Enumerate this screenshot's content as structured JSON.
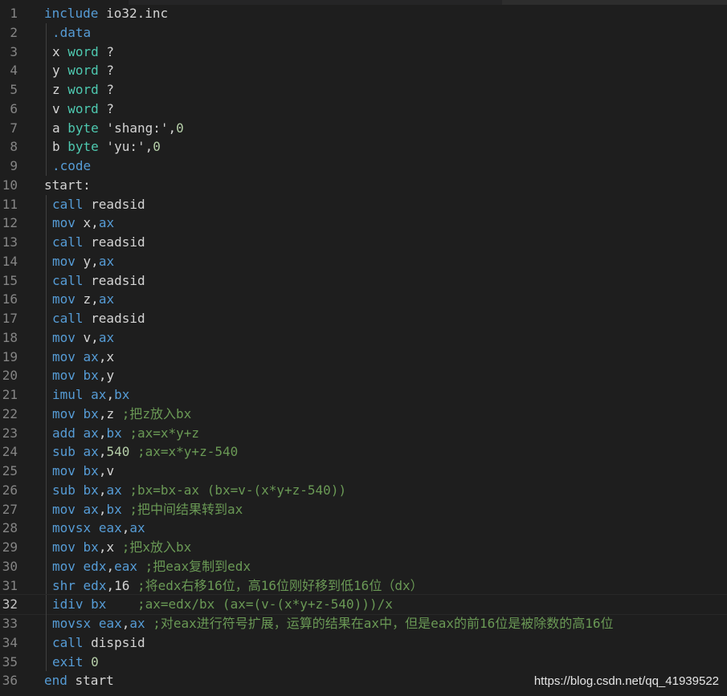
{
  "colors": {
    "background": "#1e1e1e",
    "line_number": "#858585",
    "keyword": "#569cd6",
    "type": "#4ec9b0",
    "number": "#b5cea8",
    "string": "#ce9178",
    "comment": "#6a9955",
    "text": "#d4d4d4"
  },
  "editor": {
    "current_line": 32,
    "lines": [
      {
        "n": "1",
        "indent": false,
        "tokens": [
          {
            "t": "kw",
            "v": "include"
          },
          {
            "t": "id",
            "v": " io32.inc"
          }
        ]
      },
      {
        "n": "2",
        "indent": true,
        "tokens": [
          {
            "t": "kw",
            "v": ".data"
          }
        ]
      },
      {
        "n": "3",
        "indent": true,
        "tokens": [
          {
            "t": "id",
            "v": "x "
          },
          {
            "t": "ty",
            "v": "word"
          },
          {
            "t": "id",
            "v": " ?"
          }
        ]
      },
      {
        "n": "4",
        "indent": true,
        "tokens": [
          {
            "t": "id",
            "v": "y "
          },
          {
            "t": "ty",
            "v": "word"
          },
          {
            "t": "id",
            "v": " ?"
          }
        ]
      },
      {
        "n": "5",
        "indent": true,
        "tokens": [
          {
            "t": "id",
            "v": "z "
          },
          {
            "t": "ty",
            "v": "word"
          },
          {
            "t": "id",
            "v": " ?"
          }
        ]
      },
      {
        "n": "6",
        "indent": true,
        "tokens": [
          {
            "t": "id",
            "v": "v "
          },
          {
            "t": "ty",
            "v": "word"
          },
          {
            "t": "id",
            "v": " ?"
          }
        ]
      },
      {
        "n": "7",
        "indent": true,
        "tokens": [
          {
            "t": "id",
            "v": "a "
          },
          {
            "t": "ty",
            "v": "byte"
          },
          {
            "t": "id",
            "v": " 'shang:',"
          },
          {
            "t": "num",
            "v": "0"
          }
        ]
      },
      {
        "n": "8",
        "indent": true,
        "tokens": [
          {
            "t": "id",
            "v": "b "
          },
          {
            "t": "ty",
            "v": "byte"
          },
          {
            "t": "id",
            "v": " 'yu:',"
          },
          {
            "t": "num",
            "v": "0"
          }
        ]
      },
      {
        "n": "9",
        "indent": true,
        "tokens": [
          {
            "t": "kw",
            "v": ".code"
          }
        ]
      },
      {
        "n": "10",
        "indent": false,
        "tokens": [
          {
            "t": "id",
            "v": "start:"
          }
        ]
      },
      {
        "n": "11",
        "indent": true,
        "tokens": [
          {
            "t": "kw",
            "v": "call"
          },
          {
            "t": "id",
            "v": " readsid"
          }
        ]
      },
      {
        "n": "12",
        "indent": true,
        "tokens": [
          {
            "t": "kw",
            "v": "mov"
          },
          {
            "t": "id",
            "v": " x,"
          },
          {
            "t": "reg",
            "v": "ax"
          }
        ]
      },
      {
        "n": "13",
        "indent": true,
        "tokens": [
          {
            "t": "kw",
            "v": "call"
          },
          {
            "t": "id",
            "v": " readsid"
          }
        ]
      },
      {
        "n": "14",
        "indent": true,
        "tokens": [
          {
            "t": "kw",
            "v": "mov"
          },
          {
            "t": "id",
            "v": " y,"
          },
          {
            "t": "reg",
            "v": "ax"
          }
        ]
      },
      {
        "n": "15",
        "indent": true,
        "tokens": [
          {
            "t": "kw",
            "v": "call"
          },
          {
            "t": "id",
            "v": " readsid"
          }
        ]
      },
      {
        "n": "16",
        "indent": true,
        "tokens": [
          {
            "t": "kw",
            "v": "mov"
          },
          {
            "t": "id",
            "v": " z,"
          },
          {
            "t": "reg",
            "v": "ax"
          }
        ]
      },
      {
        "n": "17",
        "indent": true,
        "tokens": [
          {
            "t": "kw",
            "v": "call"
          },
          {
            "t": "id",
            "v": " readsid"
          }
        ]
      },
      {
        "n": "18",
        "indent": true,
        "tokens": [
          {
            "t": "kw",
            "v": "mov"
          },
          {
            "t": "id",
            "v": " v,"
          },
          {
            "t": "reg",
            "v": "ax"
          }
        ]
      },
      {
        "n": "19",
        "indent": true,
        "tokens": [
          {
            "t": "kw",
            "v": "mov"
          },
          {
            "t": "id",
            "v": " "
          },
          {
            "t": "reg",
            "v": "ax"
          },
          {
            "t": "id",
            "v": ",x"
          }
        ]
      },
      {
        "n": "20",
        "indent": true,
        "tokens": [
          {
            "t": "kw",
            "v": "mov"
          },
          {
            "t": "id",
            "v": " "
          },
          {
            "t": "reg",
            "v": "bx"
          },
          {
            "t": "id",
            "v": ",y"
          }
        ]
      },
      {
        "n": "21",
        "indent": true,
        "tokens": [
          {
            "t": "kw",
            "v": "imul"
          },
          {
            "t": "id",
            "v": " "
          },
          {
            "t": "reg",
            "v": "ax"
          },
          {
            "t": "id",
            "v": ","
          },
          {
            "t": "reg",
            "v": "bx"
          }
        ]
      },
      {
        "n": "22",
        "indent": true,
        "tokens": [
          {
            "t": "kw",
            "v": "mov"
          },
          {
            "t": "id",
            "v": " "
          },
          {
            "t": "reg",
            "v": "bx"
          },
          {
            "t": "id",
            "v": ",z "
          },
          {
            "t": "cm",
            "v": ";把z放入bx"
          }
        ]
      },
      {
        "n": "23",
        "indent": true,
        "tokens": [
          {
            "t": "kw",
            "v": "add"
          },
          {
            "t": "id",
            "v": " "
          },
          {
            "t": "reg",
            "v": "ax"
          },
          {
            "t": "id",
            "v": ","
          },
          {
            "t": "reg",
            "v": "bx"
          },
          {
            "t": "id",
            "v": " "
          },
          {
            "t": "cm",
            "v": ";ax=x*y+z"
          }
        ]
      },
      {
        "n": "24",
        "indent": true,
        "tokens": [
          {
            "t": "kw",
            "v": "sub"
          },
          {
            "t": "id",
            "v": " "
          },
          {
            "t": "reg",
            "v": "ax"
          },
          {
            "t": "id",
            "v": ","
          },
          {
            "t": "num",
            "v": "540"
          },
          {
            "t": "id",
            "v": " "
          },
          {
            "t": "cm",
            "v": ";ax=x*y+z-540"
          }
        ]
      },
      {
        "n": "25",
        "indent": true,
        "tokens": [
          {
            "t": "kw",
            "v": "mov"
          },
          {
            "t": "id",
            "v": " "
          },
          {
            "t": "reg",
            "v": "bx"
          },
          {
            "t": "id",
            "v": ",v"
          }
        ]
      },
      {
        "n": "26",
        "indent": true,
        "tokens": [
          {
            "t": "kw",
            "v": "sub"
          },
          {
            "t": "id",
            "v": " "
          },
          {
            "t": "reg",
            "v": "bx"
          },
          {
            "t": "id",
            "v": ","
          },
          {
            "t": "reg",
            "v": "ax"
          },
          {
            "t": "id",
            "v": " "
          },
          {
            "t": "cm",
            "v": ";bx=bx-ax (bx=v-(x*y+z-540))"
          }
        ]
      },
      {
        "n": "27",
        "indent": true,
        "tokens": [
          {
            "t": "kw",
            "v": "mov"
          },
          {
            "t": "id",
            "v": " "
          },
          {
            "t": "reg",
            "v": "ax"
          },
          {
            "t": "id",
            "v": ","
          },
          {
            "t": "reg",
            "v": "bx"
          },
          {
            "t": "id",
            "v": " "
          },
          {
            "t": "cm",
            "v": ";把中间结果转到ax"
          }
        ]
      },
      {
        "n": "28",
        "indent": true,
        "tokens": [
          {
            "t": "kw",
            "v": "movsx"
          },
          {
            "t": "id",
            "v": " "
          },
          {
            "t": "reg",
            "v": "eax"
          },
          {
            "t": "id",
            "v": ","
          },
          {
            "t": "reg",
            "v": "ax"
          }
        ]
      },
      {
        "n": "29",
        "indent": true,
        "tokens": [
          {
            "t": "kw",
            "v": "mov"
          },
          {
            "t": "id",
            "v": " "
          },
          {
            "t": "reg",
            "v": "bx"
          },
          {
            "t": "id",
            "v": ",x "
          },
          {
            "t": "cm",
            "v": ";把x放入bx"
          }
        ]
      },
      {
        "n": "30",
        "indent": true,
        "tokens": [
          {
            "t": "kw",
            "v": "mov"
          },
          {
            "t": "id",
            "v": " "
          },
          {
            "t": "reg",
            "v": "edx"
          },
          {
            "t": "id",
            "v": ","
          },
          {
            "t": "reg",
            "v": "eax"
          },
          {
            "t": "id",
            "v": " "
          },
          {
            "t": "cm",
            "v": ";把eax复制到edx"
          }
        ]
      },
      {
        "n": "31",
        "indent": true,
        "tokens": [
          {
            "t": "kw",
            "v": "shr"
          },
          {
            "t": "id",
            "v": " "
          },
          {
            "t": "reg",
            "v": "edx"
          },
          {
            "t": "id",
            "v": ",16 "
          },
          {
            "t": "cm",
            "v": ";将edx右移16位，高16位刚好移到低16位（dx）"
          }
        ]
      },
      {
        "n": "32",
        "indent": true,
        "tokens": [
          {
            "t": "kw",
            "v": "idiv"
          },
          {
            "t": "id",
            "v": " "
          },
          {
            "t": "reg",
            "v": "bx"
          },
          {
            "t": "id",
            "v": "    "
          },
          {
            "t": "cm",
            "v": ";ax=edx/bx (ax=(v-(x*y+z-540)))/x"
          }
        ]
      },
      {
        "n": "33",
        "indent": true,
        "tokens": [
          {
            "t": "kw",
            "v": "movsx"
          },
          {
            "t": "id",
            "v": " "
          },
          {
            "t": "reg",
            "v": "eax"
          },
          {
            "t": "id",
            "v": ","
          },
          {
            "t": "reg",
            "v": "ax"
          },
          {
            "t": "id",
            "v": " "
          },
          {
            "t": "cm",
            "v": ";对eax进行符号扩展，运算的结果在ax中，但是eax的前16位是被除数的高16位"
          }
        ]
      },
      {
        "n": "34",
        "indent": true,
        "tokens": [
          {
            "t": "kw",
            "v": "call"
          },
          {
            "t": "id",
            "v": " dispsid"
          }
        ]
      },
      {
        "n": "35",
        "indent": true,
        "tokens": [
          {
            "t": "kw",
            "v": "exit"
          },
          {
            "t": "id",
            "v": " "
          },
          {
            "t": "num",
            "v": "0"
          }
        ]
      },
      {
        "n": "36",
        "indent": false,
        "tokens": [
          {
            "t": "kw",
            "v": "end"
          },
          {
            "t": "id",
            "v": " start"
          }
        ]
      }
    ]
  },
  "watermark": {
    "text": "https://blog.csdn.net/qq_41939522"
  }
}
